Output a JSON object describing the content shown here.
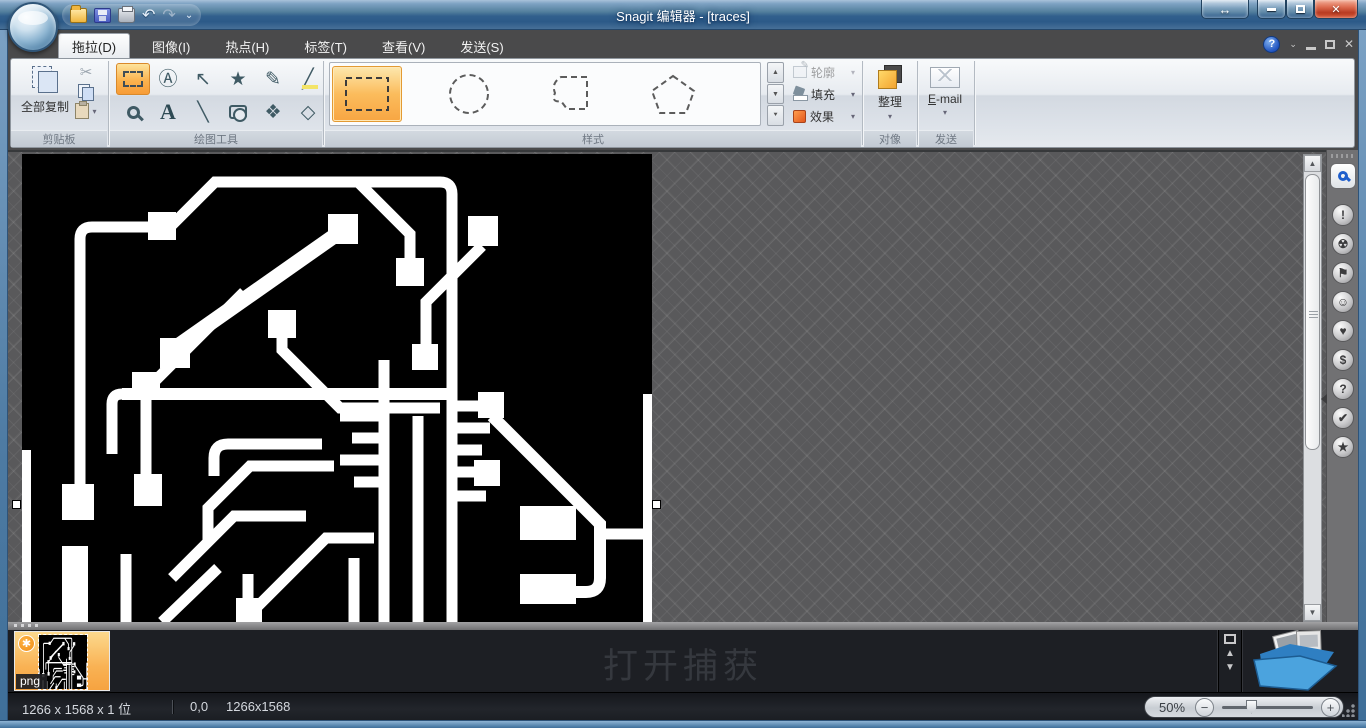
{
  "window": {
    "title": "Snagit 编辑器 - [traces]"
  },
  "quick_access": {
    "icons": [
      {
        "name": "open-icon"
      },
      {
        "name": "save-icon"
      },
      {
        "name": "print-icon"
      },
      {
        "name": "undo-icon",
        "glyph": "↶"
      },
      {
        "name": "redo-icon",
        "glyph": "↷"
      },
      {
        "name": "customize-chevron-icon",
        "glyph": "⌄"
      }
    ]
  },
  "tabs": {
    "items": [
      {
        "label": "拖拉(D)",
        "active": true
      },
      {
        "label": "图像(I)"
      },
      {
        "label": "热点(H)"
      },
      {
        "label": "标签(T)"
      },
      {
        "label": "查看(V)"
      },
      {
        "label": "发送(S)"
      }
    ]
  },
  "doc_controls": {
    "help": "?"
  },
  "ribbon": {
    "groups": {
      "clipboard": {
        "label": "剪贴板",
        "copy_all_label": "全部复制"
      },
      "drawing": {
        "label": "绘图工具",
        "tools": [
          {
            "name": "selection-tool",
            "glyph": ""
          },
          {
            "name": "callout-tool",
            "glyph": "Ⓐ"
          },
          {
            "name": "arrow-tool",
            "glyph": "↖"
          },
          {
            "name": "stamp-tool",
            "glyph": "★"
          },
          {
            "name": "pen-tool",
            "glyph": "✎"
          },
          {
            "name": "highlighter-tool",
            "glyph": "╱"
          },
          {
            "name": "zoom-tool",
            "glyph": ""
          },
          {
            "name": "text-tool",
            "glyph": "A"
          },
          {
            "name": "line-tool",
            "glyph": "╲"
          },
          {
            "name": "shape-tool",
            "glyph": ""
          },
          {
            "name": "fill-tool",
            "glyph": "❖"
          },
          {
            "name": "eraser-tool",
            "glyph": "◇"
          }
        ]
      },
      "style": {
        "label": "样式",
        "outline_label": "轮廓",
        "fill_label": "填充",
        "effects_label": "效果"
      },
      "object": {
        "label": "对像",
        "arrange_label": "整理"
      },
      "send": {
        "label": "发送",
        "email_label": "E-mail"
      }
    }
  },
  "side_panel": {
    "stamps": [
      {
        "name": "exclamation-stamp-icon",
        "glyph": "!"
      },
      {
        "name": "radiation-stamp-icon",
        "glyph": "☢"
      },
      {
        "name": "flag-stamp-icon",
        "glyph": "⚑"
      },
      {
        "name": "smiley-stamp-icon",
        "glyph": "☺"
      },
      {
        "name": "heart-stamp-icon",
        "glyph": "♥"
      },
      {
        "name": "dollar-stamp-icon",
        "glyph": "$"
      },
      {
        "name": "question-stamp-icon",
        "glyph": "?"
      },
      {
        "name": "check-stamp-icon",
        "glyph": "✔"
      },
      {
        "name": "star-stamp-icon",
        "glyph": "★"
      }
    ]
  },
  "tray": {
    "watermark": "打开捕获",
    "thumbnail_label": "png"
  },
  "status_bar": {
    "image_info": "1266 x 1568 x 1 位",
    "cursor_pos": "0,0",
    "selection_size": "1266x1568",
    "zoom_level": "50%"
  },
  "colors": {
    "accent_orange": "#f8a643",
    "title_blue": "#32608d",
    "canvas_gray": "#59595b",
    "tray_black": "#1d1f24"
  }
}
